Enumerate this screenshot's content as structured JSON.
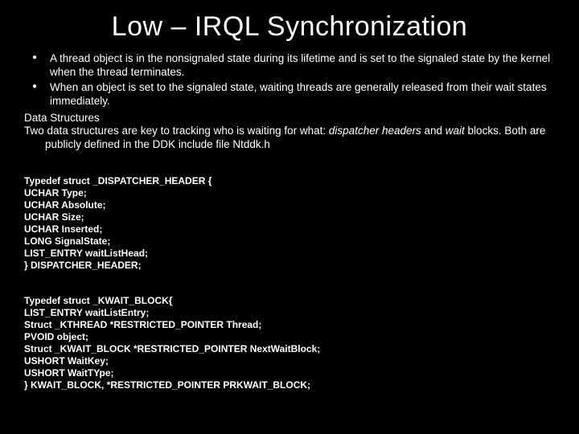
{
  "title": "Low – IRQL Synchronization",
  "bullets": [
    "A thread object is in the nonsignaled state during its lifetime and is set to the signaled state by the kernel when the thread terminates.",
    "When an object is set to the signaled state, waiting threads are generally released from their wait states immediately."
  ],
  "sectionHeading": "Data Structures",
  "para1_a": "Two data structures are key to tracking who is waiting for what: ",
  "para1_b": "dispatcher headers",
  "para1_c": " and ",
  "para1_d": "wait",
  "para1_e": " blocks. Both are publicly defined in the DDK include file Ntddk.h",
  "code1": [
    "Typedef struct _DISPATCHER_HEADER {",
    "UCHAR Type;",
    "UCHAR Absolute;",
    "UCHAR Size;",
    "UCHAR Inserted;",
    "LONG SignalState;",
    "LIST_ENTRY waitListHead;",
    "} DISPATCHER_HEADER;"
  ],
  "code2": [
    "Typedef struct _KWAIT_BLOCK{",
    "LIST_ENTRY waitListEntry;",
    "Struct _KTHREAD *RESTRICTED_POINTER Thread;",
    "PVOID object;",
    "Struct _KWAIT_BLOCK *RESTRICTED_POINTER NextWaitBlock;",
    "USHORT WaitKey;",
    "USHORT WaitTYpe;",
    "} KWAIT_BLOCK, *RESTRICTED_POINTER PRKWAIT_BLOCK;"
  ]
}
